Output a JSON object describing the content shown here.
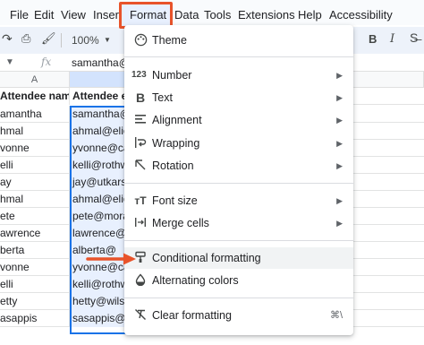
{
  "menubar": {
    "items": [
      "File",
      "Edit",
      "View",
      "Insert",
      "Format",
      "Data",
      "Tools",
      "Extensions",
      "Help",
      "Accessibility"
    ]
  },
  "toolbar": {
    "zoom": "100%",
    "bold": "B"
  },
  "formula_bar": {
    "fx_label": "fx",
    "value": "samantha@n"
  },
  "grid": {
    "col_a": "A",
    "col_b": "B",
    "header_a": "Attendee name",
    "header_b": "Attendee e",
    "rows": [
      {
        "a": "amantha",
        "b": "samantha@"
      },
      {
        "a": "hmal",
        "b": "ahmal@elie"
      },
      {
        "a": "vonne",
        "b": "yvonne@ca"
      },
      {
        "a": "elli",
        "b": "kelli@rothw"
      },
      {
        "a": "ay",
        "b": "jay@utkars"
      },
      {
        "a": "hmal",
        "b": "ahmal@elie"
      },
      {
        "a": "ete",
        "b": "pete@mora"
      },
      {
        "a": "awrence",
        "b": "lawrence@"
      },
      {
        "a": "berta",
        "b": "alberta@"
      },
      {
        "a": "vonne",
        "b": "yvonne@ca"
      },
      {
        "a": "elli",
        "b": "kelli@rothw"
      },
      {
        "a": "etty",
        "b": "hetty@wils"
      },
      {
        "a": "asappis",
        "b": "sasappis@"
      }
    ]
  },
  "format_menu": {
    "theme": "Theme",
    "number": "Number",
    "text": "Text",
    "alignment": "Alignment",
    "wrapping": "Wrapping",
    "rotation": "Rotation",
    "font_size": "Font size",
    "merge_cells": "Merge cells",
    "conditional_formatting": "Conditional formatting",
    "alternating_colors": "Alternating colors",
    "clear_formatting": "Clear formatting",
    "clear_shortcut": "⌘\\"
  },
  "colors": {
    "accent": "#1a73e8",
    "highlight_box": "#e8532a",
    "pointer_arrow": "#e8532a",
    "selection_fill": "#e8f0fe"
  }
}
